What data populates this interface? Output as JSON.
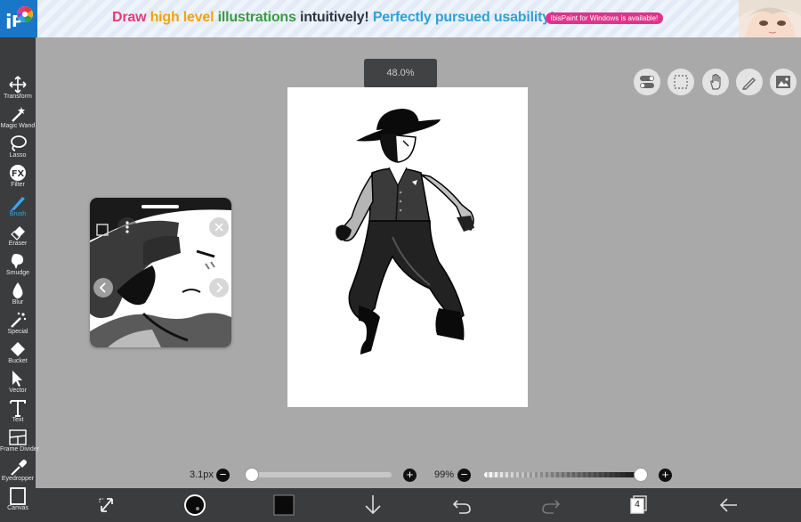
{
  "banner": {
    "part1": "Draw ",
    "part2": "high level ",
    "part3": "illustrations ",
    "part4": "intuitively! ",
    "part5": "Perfectly pursued usability!",
    "badge": "ibisPaint for Windows is available!"
  },
  "tools": [
    {
      "label": "Transform",
      "icon": "transform-icon"
    },
    {
      "label": "Magic Wand",
      "icon": "magic-wand-icon"
    },
    {
      "label": "Lasso",
      "icon": "lasso-icon"
    },
    {
      "label": "Filter",
      "icon": "filter-fx-icon"
    },
    {
      "label": "Brush",
      "icon": "brush-icon",
      "active": true
    },
    {
      "label": "Eraser",
      "icon": "eraser-icon"
    },
    {
      "label": "Smudge",
      "icon": "smudge-icon"
    },
    {
      "label": "Blur",
      "icon": "blur-drop-icon"
    },
    {
      "label": "Special",
      "icon": "special-wand-icon"
    },
    {
      "label": "Bucket",
      "icon": "bucket-icon"
    },
    {
      "label": "Vector",
      "icon": "vector-cursor-icon"
    },
    {
      "label": "Text",
      "icon": "text-t-icon"
    },
    {
      "label": "Frame Divider",
      "icon": "frame-divider-icon"
    },
    {
      "label": "Eyedropper",
      "icon": "eyedropper-icon"
    },
    {
      "label": "Canvas",
      "icon": "canvas-icon"
    }
  ],
  "zoom_label": "48.0%",
  "brush_size": {
    "label": "3.1px",
    "level": 0.0
  },
  "opacity": {
    "label": "99%",
    "level": 0.99
  },
  "layers_count": "4",
  "colors": {
    "accent": "#38a8f0",
    "toolbar": "#3b3c3e",
    "workspace": "#a9a9a9"
  },
  "right_buttons": [
    "toggle-icon",
    "selection-icon",
    "hand-icon",
    "pencil-icon",
    "image-icon"
  ],
  "bottom_icons": [
    "transform-arrows-icon",
    "brush-preview-icon",
    "color-swatch-icon",
    "down-arrow-icon",
    "undo-icon",
    "redo-icon",
    "layers-icon",
    "back-arrow-icon"
  ]
}
